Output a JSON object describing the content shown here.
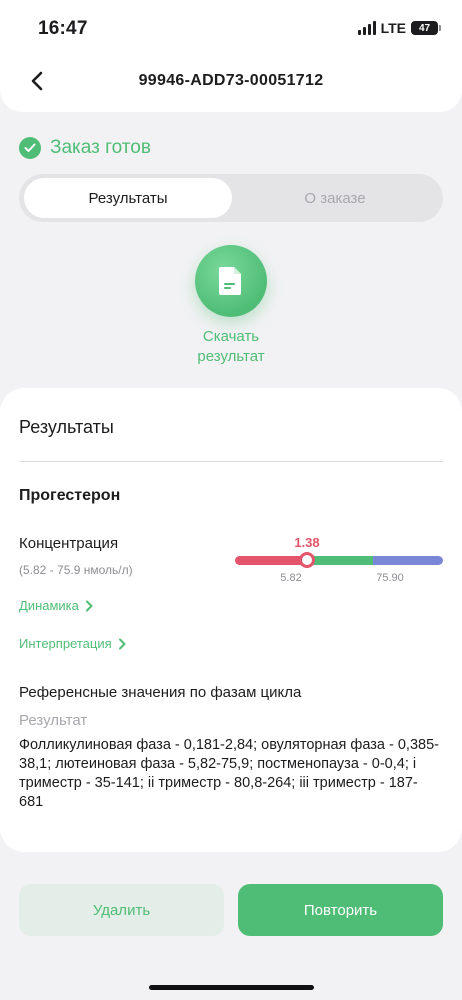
{
  "status_bar": {
    "time": "16:47",
    "network": "LTE",
    "battery": "47"
  },
  "header": {
    "order_id": "99946-ADD73-00051712"
  },
  "order_status": {
    "text": "Заказ готов"
  },
  "tabs": [
    {
      "label": "Результаты",
      "active": true
    },
    {
      "label": "О заказе",
      "active": false
    }
  ],
  "download": {
    "label": "Скачать\nрезультат"
  },
  "results": {
    "title": "Результаты",
    "analyte": "Прогестерон",
    "concentration_label": "Концентрация",
    "reference_range": "(5.82 - 75.9 нмоль/л)",
    "value": "1.38",
    "scale": {
      "low": "5.82",
      "high": "75.90"
    },
    "links": {
      "dynamics": "Динамика",
      "interpretation": "Интерпретация"
    },
    "reference_title": "Референсные значения по фазам цикла",
    "reference_subtitle": "Результат",
    "reference_text": "Фолликулиновая фаза - 0,181-2,84; овуляторная фаза - 0,385-38,1; лютеиновая фаза - 5,82-75,9; постменопауза - 0-0,4; i триместр - 35-141; ii триместр - 80,8-264; iii триместр - 187-681"
  },
  "actions": {
    "delete": "Удалить",
    "repeat": "Повторить"
  },
  "colors": {
    "accent": "#4fbd76",
    "low": "#e2556a",
    "high": "#7a87d6"
  }
}
